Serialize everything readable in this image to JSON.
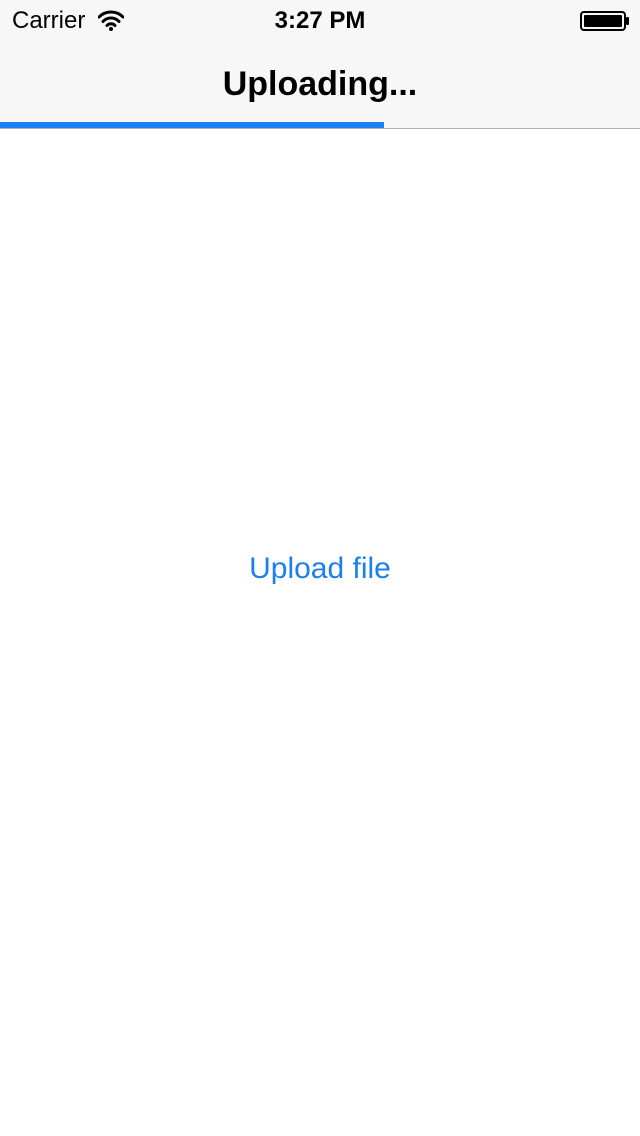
{
  "status_bar": {
    "carrier": "Carrier",
    "time": "3:27 PM",
    "icons": [
      "wifi-icon",
      "battery-icon"
    ]
  },
  "nav": {
    "title": "Uploading..."
  },
  "upload_progress": {
    "fraction": 0.6
  },
  "main": {
    "upload_button_label": "Upload file"
  },
  "colors": {
    "accent": "#1a7ff0",
    "bar_background": "#f7f7f7",
    "hairline": "#b2b2b2",
    "text": "#000000"
  }
}
